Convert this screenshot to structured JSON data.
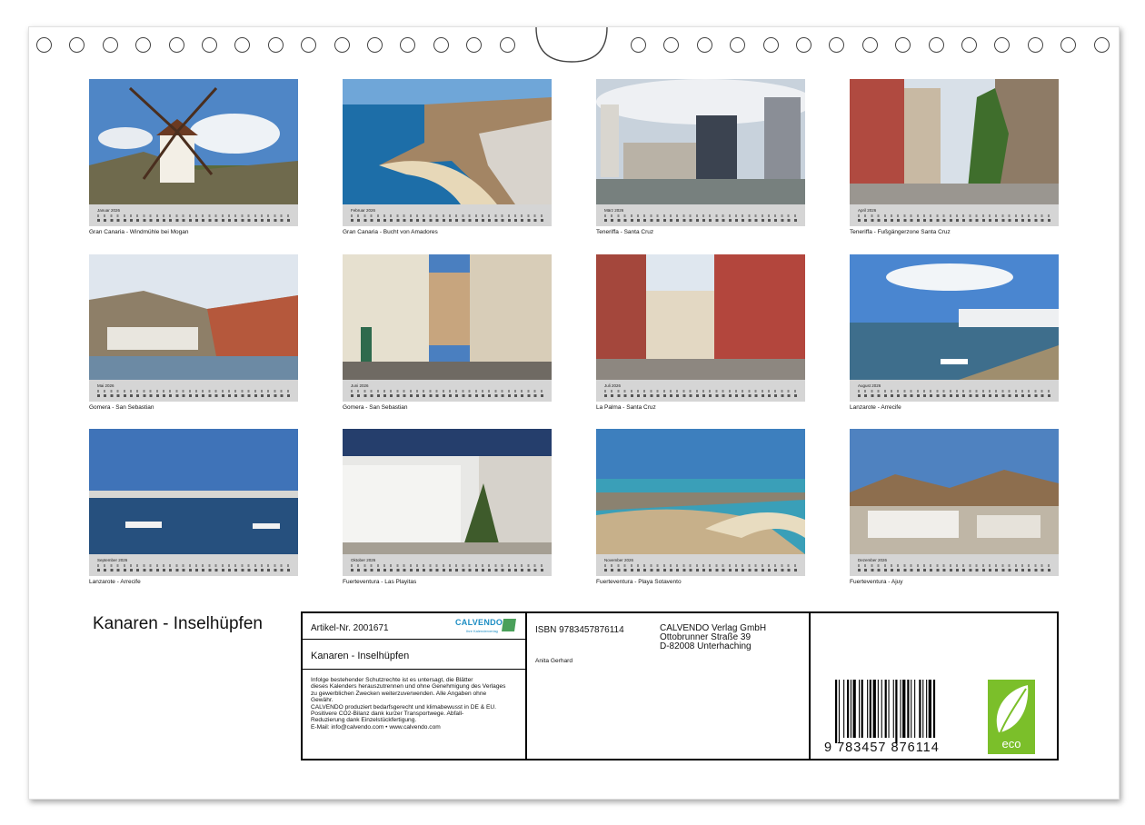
{
  "calendar": {
    "title": "Kanaren - Inselhüpfen",
    "months": [
      {
        "month": "Januar 2026",
        "caption": "Gran Canaria - Windmühle bei Mogan",
        "scene": "windmill"
      },
      {
        "month": "Februar 2026",
        "caption": "Gran Canaria - Bucht von Amadores",
        "scene": "bay"
      },
      {
        "month": "März 2026",
        "caption": "Teneriffa - Santa Cruz",
        "scene": "city"
      },
      {
        "month": "April 2026",
        "caption": "Teneriffa - Fußgängerzone Santa Cruz",
        "scene": "street"
      },
      {
        "month": "Mai 2026",
        "caption": "Gomera - San Sebastian",
        "scene": "harbour"
      },
      {
        "month": "Juni 2026",
        "caption": "Gomera - San Sebastian",
        "scene": "alley"
      },
      {
        "month": "Juli 2026",
        "caption": "La Palma - Santa Cruz",
        "scene": "street2"
      },
      {
        "month": "August 2026",
        "caption": "Lanzarote - Arrecife",
        "scene": "boats"
      },
      {
        "month": "September 2026",
        "caption": "Lanzarote - Arrecife",
        "scene": "marina"
      },
      {
        "month": "Oktober 2026",
        "caption": "Fuerteventura - Las Playitas",
        "scene": "village"
      },
      {
        "month": "November 2026",
        "caption": "Fuerteventura - Playa Sotavento",
        "scene": "dunes"
      },
      {
        "month": "Dezember 2026",
        "caption": "Fuerteventura - Ajuy",
        "scene": "hills"
      }
    ]
  },
  "info": {
    "article": "Artikel-Nr. 2001671",
    "logo_text": "CALVENDO",
    "logo_sub": "Ihre Kalenderverlag",
    "subtitle": "Kanaren - Inselhüpfen",
    "legal": [
      "Infolge bestehender Schutzrechte ist es untersagt, die Blätter",
      "dieses Kalenders herauszutrennen und ohne Genehmigung des Verlages",
      "zu gewerblichen Zwecken weiterzuverwenden. Alle Angaben ohne",
      "Gewähr.",
      "CALVENDO produziert bedarfsgerecht und klimabewusst in DE & EU.",
      "Positivere CO2-Bilanz dank kurzer Transportwege. Abfall-",
      "Reduzierung dank Einzelstückfertigung.",
      "E-Mail: info@calvendo.com • www.calvendo.com"
    ],
    "isbn": "ISBN 9783457876114",
    "author": "Anita Gerhard",
    "publisher": [
      "CALVENDO Verlag GmbH",
      "Ottobrunner Straße 39",
      "D-82008 Unterhaching"
    ],
    "barcode_number": "9 783457 876114",
    "eco_label": "eco",
    "colors": {
      "eco_green": "#7bbf2a",
      "logo_blue": "#1e8ec4"
    }
  }
}
